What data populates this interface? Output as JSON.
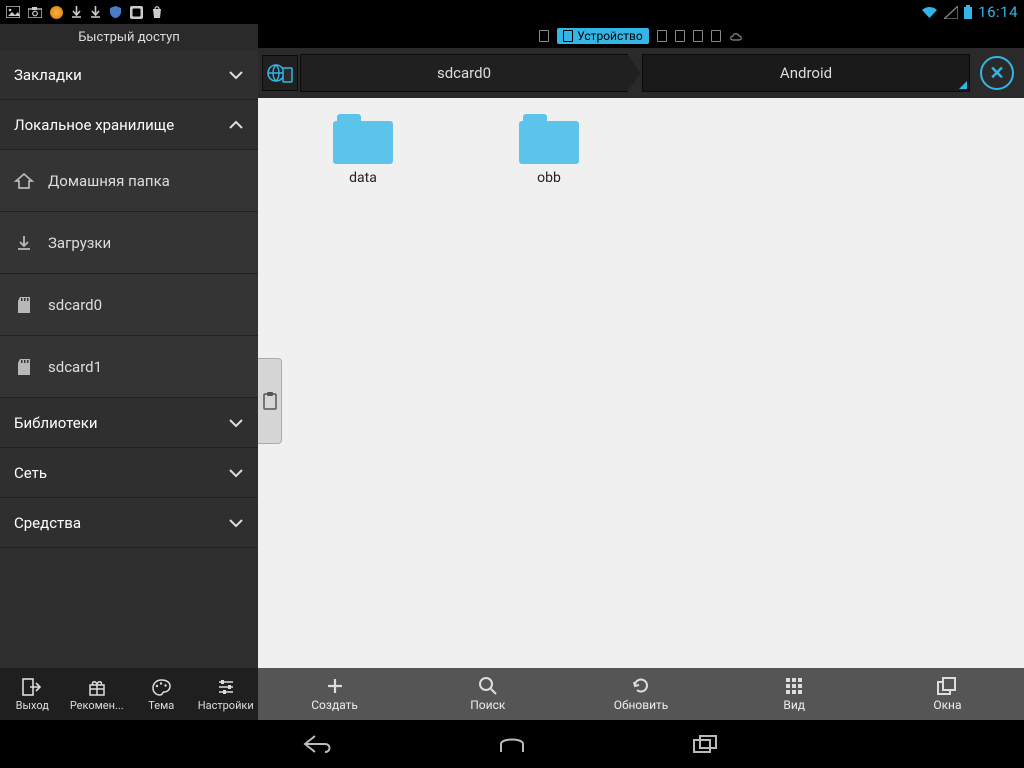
{
  "status": {
    "clock": "16:14"
  },
  "tabstrip": {
    "active_label": "Устройство"
  },
  "sidebar": {
    "title": "Быстрый доступ",
    "sections": {
      "bookmarks": "Закладки",
      "local": "Локальное хранилище",
      "libraries": "Библиотеки",
      "network": "Сеть",
      "tools": "Средства"
    },
    "local_items": [
      {
        "label": "Домашняя папка",
        "id": "home"
      },
      {
        "label": "Загрузки",
        "id": "downloads"
      },
      {
        "label": "sdcard0",
        "id": "sdcard0"
      },
      {
        "label": "sdcard1",
        "id": "sdcard1"
      }
    ],
    "bottom": [
      {
        "id": "exit",
        "label": "Выход"
      },
      {
        "id": "recommend",
        "label": "Рекомен..."
      },
      {
        "id": "theme",
        "label": "Тема"
      },
      {
        "id": "settings",
        "label": "Настройки"
      }
    ]
  },
  "path": {
    "crumb0": "sdcard0",
    "crumb1": "Android"
  },
  "folders": [
    {
      "name": "data"
    },
    {
      "name": "obb"
    }
  ],
  "bottombar": [
    {
      "id": "create",
      "label": "Создать"
    },
    {
      "id": "search",
      "label": "Поиск"
    },
    {
      "id": "refresh",
      "label": "Обновить"
    },
    {
      "id": "view",
      "label": "Вид"
    },
    {
      "id": "windows",
      "label": "Окна"
    }
  ]
}
